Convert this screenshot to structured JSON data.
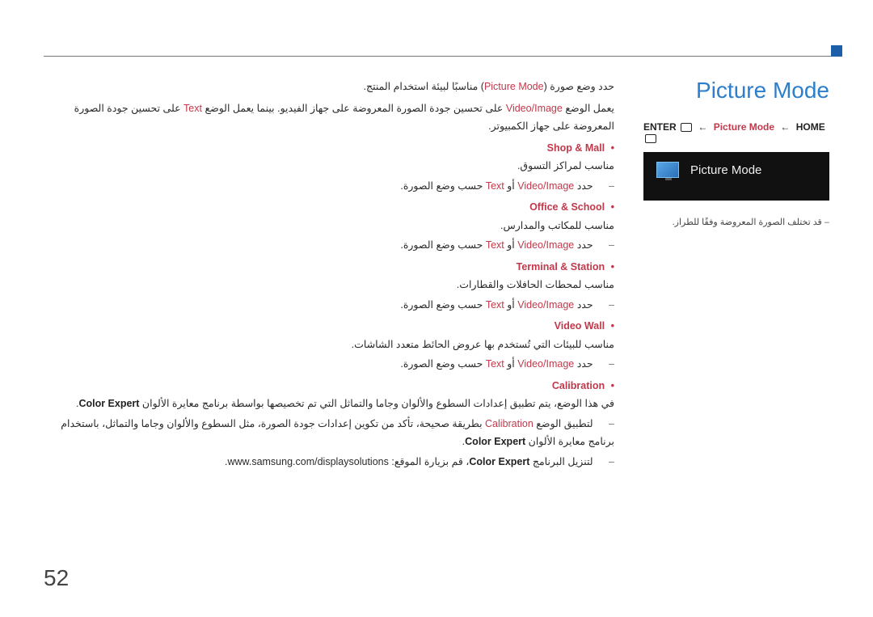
{
  "page_number": "52",
  "title": "Picture Mode",
  "breadcrumb": {
    "left": "ENTER",
    "mid": "Picture Mode",
    "right": "HOME"
  },
  "menu": {
    "label": "Picture Mode"
  },
  "note": "قد تختلف الصورة المعروضة وفقًا للطراز.",
  "intro": {
    "line1_a": "حدد وضع صورة (",
    "line1_hl": "Picture Mode",
    "line1_b": ") مناسبًا لبيئة استخدام المنتج.",
    "line2_a": "يعمل الوضع ",
    "line2_hl1": "Video/Image",
    "line2_b": " على تحسين جودة الصورة المعروضة على جهاز الفيديو. بينما يعمل الوضع ",
    "line2_hl2": "Text",
    "line2_c": " على تحسين جودة الصورة المعروضة على جهاز الكمبيوتر."
  },
  "modes": [
    {
      "name": "Shop & Mall",
      "desc": "مناسب لمراكز التسوق.",
      "sub_a": "حدد ",
      "sub_hl1": "Video/Image",
      "sub_mid": " أو ",
      "sub_hl2": "Text",
      "sub_b": " حسب وضع الصورة."
    },
    {
      "name": "Office & School",
      "desc": "مناسب للمكاتب والمدارس.",
      "sub_a": "حدد ",
      "sub_hl1": "Video/Image",
      "sub_mid": " أو ",
      "sub_hl2": "Text",
      "sub_b": " حسب وضع الصورة."
    },
    {
      "name": "Terminal & Station",
      "desc": "مناسب لمحطات الحافلات والقطارات.",
      "sub_a": "حدد ",
      "sub_hl1": "Video/Image",
      "sub_mid": " أو ",
      "sub_hl2": "Text",
      "sub_b": " حسب وضع الصورة."
    },
    {
      "name": "Video Wall",
      "desc": "مناسب للبيئات التي تُستخدم بها عروض الحائط متعدد الشاشات.",
      "sub_a": "حدد ",
      "sub_hl1": "Video/Image",
      "sub_mid": " أو ",
      "sub_hl2": "Text",
      "sub_b": " حسب وضع الصورة."
    }
  ],
  "calibration": {
    "name": "Calibration",
    "desc_a": "في هذا الوضع، يتم تطبيق إعدادات السطوع والألوان وجاما والتماثل التي تم تخصيصها بواسطة برنامج معايرة الألوان ",
    "desc_bold": "Color Expert",
    "desc_b": ".",
    "sub1_a": "لتطبيق الوضع ",
    "sub1_hl": "Calibration",
    "sub1_b": " بطريقة صحيحة، تأكد من تكوين إعدادات جودة الصورة، مثل السطوع والألوان وجاما والتماثل، باستخدام برنامج معايرة الألوان ",
    "sub1_bold": "Color Expert",
    "sub1_c": ".",
    "sub2_a": "لتنزيل البرنامج ",
    "sub2_bold": "Color Expert",
    "sub2_b": "، قم بزيارة الموقع: www.samsung.com/displaysolutions."
  }
}
